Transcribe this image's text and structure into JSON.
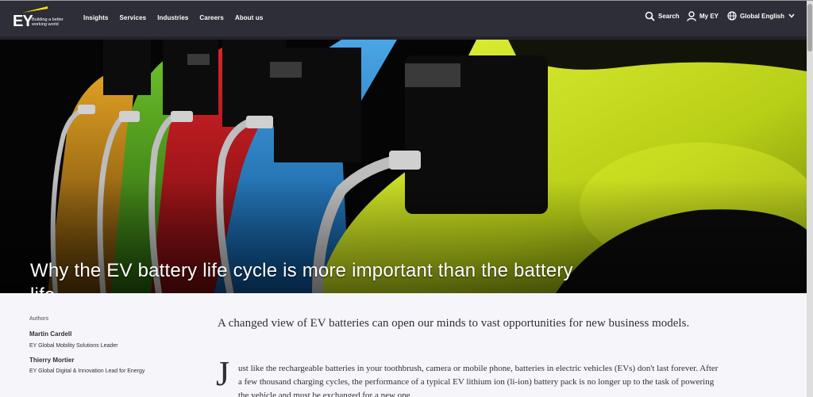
{
  "brand": {
    "logo_text": "EY",
    "tagline": "Building a better working world",
    "accent_color": "#ffe600",
    "header_color": "#2e2e38"
  },
  "nav": {
    "items": [
      "Insights",
      "Services",
      "Industries",
      "Careers",
      "About us"
    ]
  },
  "utilities": {
    "search_label": "Search",
    "search_icon": "search-icon",
    "myey_label": "My EY",
    "myey_icon": "user-icon",
    "language_label": "Global English",
    "language_icon": "globe-icon"
  },
  "hero": {
    "title": "Why the EV battery life cycle is more important than the battery life"
  },
  "authors": {
    "label": "Authors",
    "list": [
      {
        "name": "Martin Cardell",
        "role": "EY Global Mobility Solutions Leader"
      },
      {
        "name": "Thierry Mortier",
        "role": "EY Global Digital & Innovation Lead for Energy"
      }
    ]
  },
  "article": {
    "lede": "A changed view of EV batteries can open our minds to vast opportunities for new business models.",
    "drop_cap": "J",
    "body": "ust like the rechargeable batteries in your toothbrush, camera or mobile phone, batteries in electric vehicles (EVs) don't last forever. After a few thousand charging cycles, the performance of a typical EV lithium ion (li-ion) battery pack is no longer up to the task of powering the vehicle and must be exchanged for a new one."
  }
}
